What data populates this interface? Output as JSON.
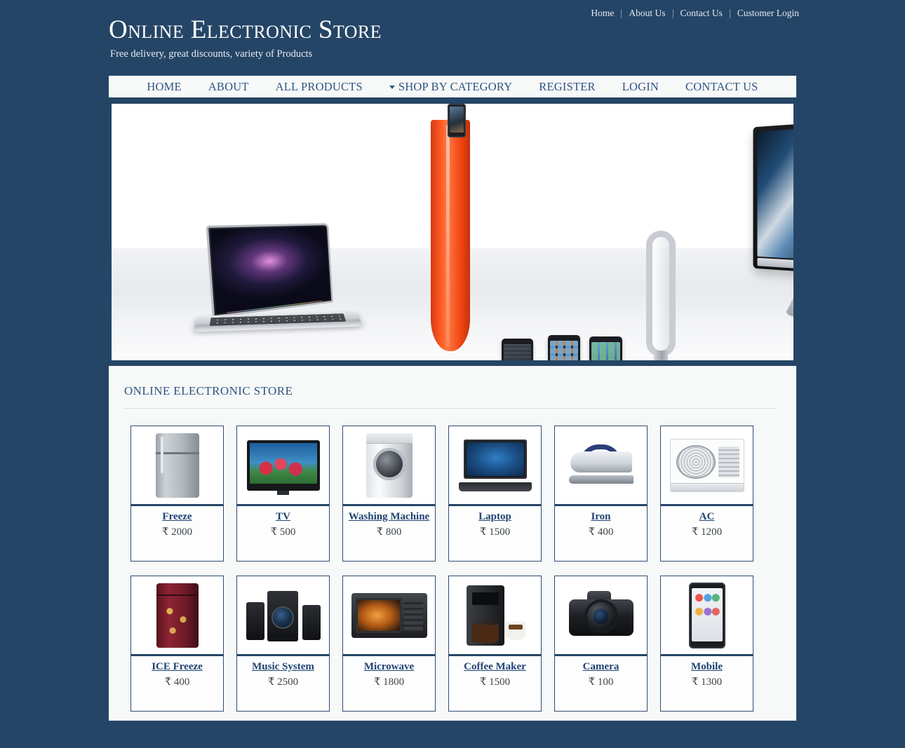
{
  "topbar": {
    "links": [
      "Home",
      "About Us",
      "Contact Us",
      "Customer Login"
    ]
  },
  "brand": {
    "title": "Online Electronic Store",
    "tagline": "Free delivery, great discounts, variety of Products"
  },
  "nav": {
    "items": [
      {
        "label": "HOME",
        "caret": false
      },
      {
        "label": "ABOUT",
        "caret": false
      },
      {
        "label": "ALL PRODUCTS",
        "caret": false
      },
      {
        "label": "SHOP BY CATEGORY",
        "caret": true
      },
      {
        "label": "REGISTER",
        "caret": false
      },
      {
        "label": "LOGIN",
        "caret": false
      },
      {
        "label": "CONTACT US",
        "caret": false
      }
    ]
  },
  "banner": {
    "alt": "electronics-banner"
  },
  "main": {
    "heading": "ONLINE ELECTRONIC STORE",
    "products": [
      {
        "name": "Freeze",
        "price": "₹ 2000",
        "thumb": "refrigerator-image"
      },
      {
        "name": "TV",
        "price": "₹ 500",
        "thumb": "television-image"
      },
      {
        "name": "Washing Machine",
        "price": "₹ 800",
        "thumb": "washing-machine-image"
      },
      {
        "name": "Laptop",
        "price": "₹ 1500",
        "thumb": "laptop-image"
      },
      {
        "name": "Iron",
        "price": "₹ 400",
        "thumb": "iron-image"
      },
      {
        "name": "AC",
        "price": "₹ 1200",
        "thumb": "air-conditioner-image"
      },
      {
        "name": "ICE Freeze",
        "price": "₹ 400",
        "thumb": "ice-refrigerator-image"
      },
      {
        "name": "Music System",
        "price": "₹ 2500",
        "thumb": "music-system-image"
      },
      {
        "name": "Microwave",
        "price": "₹ 1800",
        "thumb": "microwave-image"
      },
      {
        "name": "Coffee Maker",
        "price": "₹ 1500",
        "thumb": "coffee-maker-image"
      },
      {
        "name": "Camera",
        "price": "₹ 100",
        "thumb": "camera-image"
      },
      {
        "name": "Mobile",
        "price": "₹ 1300",
        "thumb": "mobile-phone-image"
      }
    ]
  },
  "colors": {
    "page_background": "#254566",
    "panel_background": "#f7f8f8",
    "accent_link": "#1f4372",
    "nav_link": "#2d5581"
  }
}
